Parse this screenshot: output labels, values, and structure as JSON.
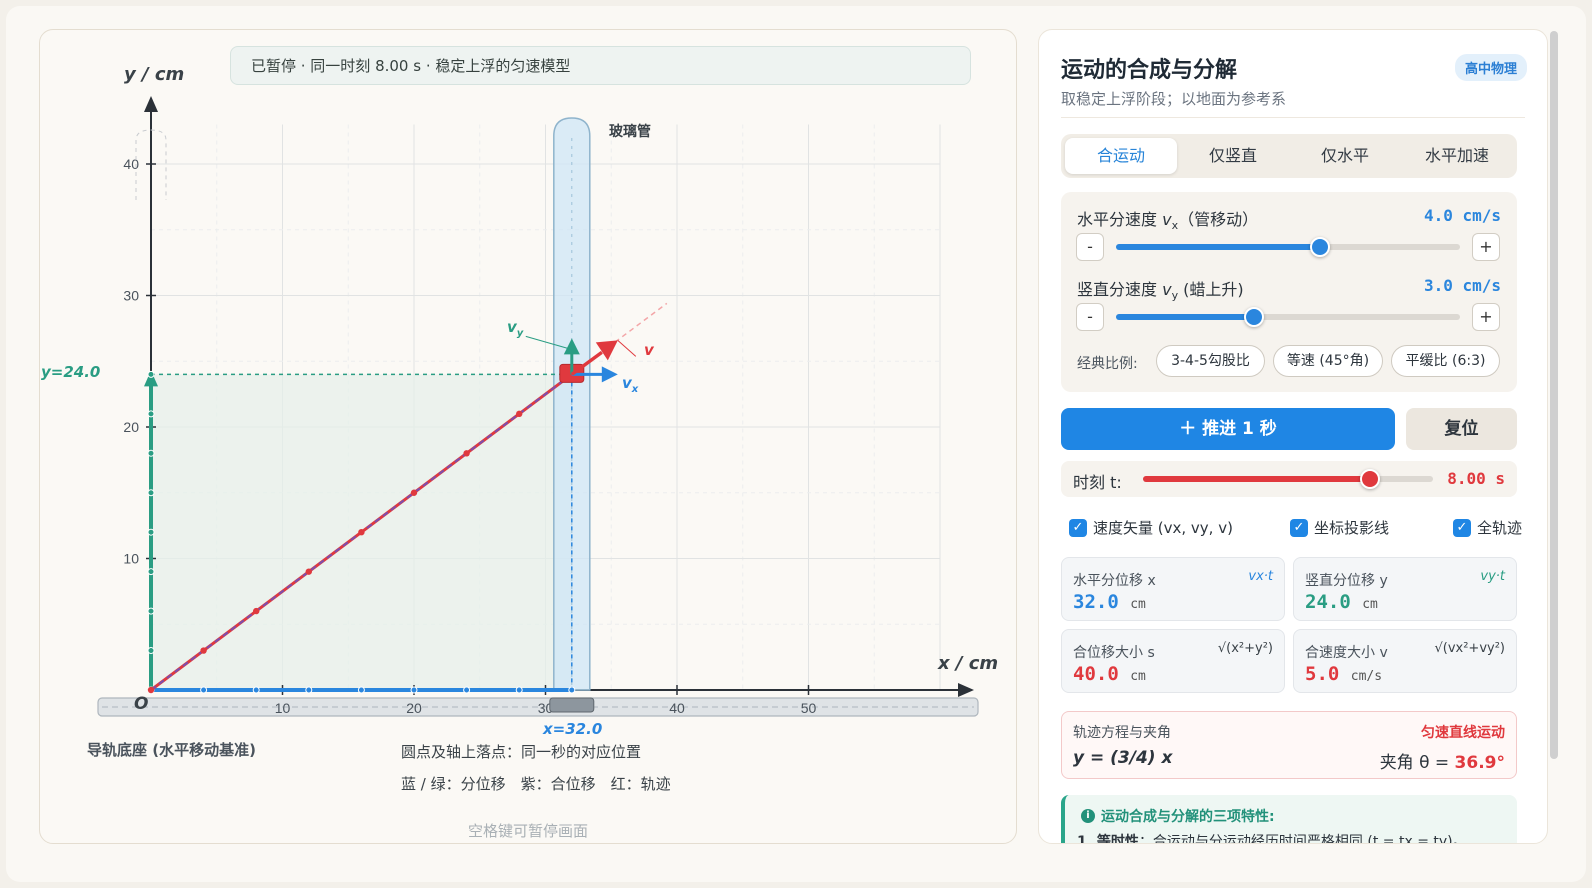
{
  "stage": {
    "status": "已暂停 · 同一时刻 8.00 s · 稳定上浮的匀速模型",
    "y_axis_label": "y / cm",
    "x_axis_label": "x / cm",
    "origin_label": "O",
    "tube_label": "玻璃管",
    "y_readout": "y=24.0",
    "x_readout": "x=32.0",
    "vy_label": "v",
    "vy_sub": "y",
    "vx_label": "v",
    "vx_sub": "x",
    "v_label": "v",
    "rail_label": "导轨底座 (水平移动基准)",
    "legend_line1": "圆点及轴上落点：同一秒的对应位置",
    "legend_line2": "蓝 / 绿：分位移　紫：合位移　红：轨迹",
    "space_hint": "空格键可暂停画面",
    "y_ticks": [
      "10",
      "20",
      "30",
      "40"
    ],
    "x_ticks": [
      "10",
      "20",
      "30",
      "40",
      "50"
    ],
    "colors": {
      "blue": "#2a86de",
      "green": "#2a9d83",
      "red": "#e0393e",
      "purple": "#7a4fb0"
    }
  },
  "chart_data": {
    "type": "line",
    "xlabel": "x / cm",
    "ylabel": "y / cm",
    "xlim": [
      0,
      62
    ],
    "ylim": [
      0,
      43
    ],
    "series": [
      {
        "name": "轨迹",
        "x": [
          0,
          4,
          8,
          12,
          16,
          20,
          24,
          28,
          32
        ],
        "y": [
          0,
          3,
          6,
          9,
          12,
          15,
          18,
          21,
          24
        ]
      }
    ],
    "current_point": {
      "x": 32.0,
      "y": 24.0
    }
  },
  "panel": {
    "title": "运动的合成与分解",
    "tag": "高中物理",
    "subtitle": "取稳定上浮阶段；以地面为参考系",
    "tabs": [
      "合运动",
      "仅竖直",
      "仅水平",
      "水平加速"
    ],
    "active_tab": 0,
    "vx": {
      "label_pre": "水平分速度 ",
      "var": "v",
      "sub": "x",
      "label_post": "（管移动）",
      "value": "4.0  cm/s",
      "fraction": 0.594
    },
    "vy": {
      "label_pre": "竖直分速度 ",
      "var": "v",
      "sub": "y",
      "label_post": " (蜡上升)",
      "value": "3.0  cm/s",
      "fraction": 0.4
    },
    "stepper_minus": "-",
    "stepper_plus": "+",
    "presets_label": "经典比例:",
    "presets": [
      "3-4-5勾股比",
      "等速 (45°角)",
      "平缓比 (6:3)"
    ],
    "advance_button": "＋ 推进 1 秒",
    "reset_button": "复位",
    "time_label": "时刻 t:",
    "time_value": "8.00 s",
    "time_fraction": 0.784,
    "checks": [
      {
        "label": "速度矢量 (vx, vy, v)",
        "checked": true
      },
      {
        "label": "坐标投影线",
        "checked": true
      },
      {
        "label": "全轨迹",
        "checked": true
      }
    ],
    "cards": [
      {
        "label": "水平分位移 x",
        "formula": "vx·t",
        "value": "32.0",
        "unit": "cm",
        "color": "#2a86de"
      },
      {
        "label": "竖直分位移 y",
        "formula": "vy·t",
        "value": "24.0",
        "unit": "cm",
        "color": "#2a9d83"
      },
      {
        "label": "合位移大小 s",
        "formula": "√(x²+y²)",
        "value": "40.0",
        "unit": "cm",
        "color": "#e0393e"
      },
      {
        "label": "合速度大小 v",
        "formula": "√(vx²+vy²)",
        "value": "5.0",
        "unit": "cm/s",
        "color": "#e0393e"
      }
    ],
    "trajectory": {
      "label": "轨迹方程与夹角",
      "motion": "匀速直线运动",
      "equation": "y = (3/4) x",
      "angle_prefix": "夹角 θ = ",
      "angle_value": "36.9°"
    },
    "info": {
      "title": "运动合成与分解的三项特性:",
      "line1_bold": "1. 等时性",
      "line1_text": "：合运动与分运动经历时间严格相同 (t = tx = ty)。"
    }
  }
}
